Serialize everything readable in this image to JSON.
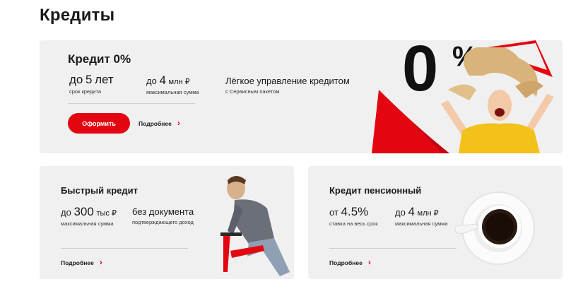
{
  "page": {
    "title": "Кредиты"
  },
  "main_card": {
    "title": "Кредит 0%",
    "stats": [
      {
        "prefix": "до",
        "value": "5",
        "unit": "лет",
        "caption": "срок кредита"
      },
      {
        "prefix": "до",
        "value": "4",
        "unit": "млн ₽",
        "caption": "максимальная сумма"
      },
      {
        "value": "Лёгкое управление кредитом",
        "caption": "с Сервисным пакетом"
      }
    ],
    "apply_label": "Оформить",
    "more_label": "Подробнее",
    "promo": {
      "big": "0",
      "percent": "%"
    }
  },
  "fast_card": {
    "title": "Быстрый кредит",
    "stats": [
      {
        "prefix": "до",
        "value": "300",
        "unit": "тыс ₽",
        "caption": "максимальная сумма"
      },
      {
        "value": "без документа",
        "caption": "подтверждающего доход"
      }
    ],
    "more_label": "Подробнее"
  },
  "pension_card": {
    "title": "Кредит пенсионный",
    "stats": [
      {
        "prefix": "от",
        "value": "4.5%",
        "caption": "ставка на весь срок"
      },
      {
        "prefix": "до",
        "value": "4",
        "unit": "млн ₽",
        "caption": "максимальная сумма"
      }
    ],
    "more_label": "Подробнее"
  },
  "colors": {
    "accent": "#e30611",
    "card_bg": "#f0f0f0",
    "text": "#1a1a1a",
    "woman_top": "#f2c21a"
  },
  "icons": {
    "chevron": "›",
    "more_link_icon": "chevron-right-icon"
  }
}
